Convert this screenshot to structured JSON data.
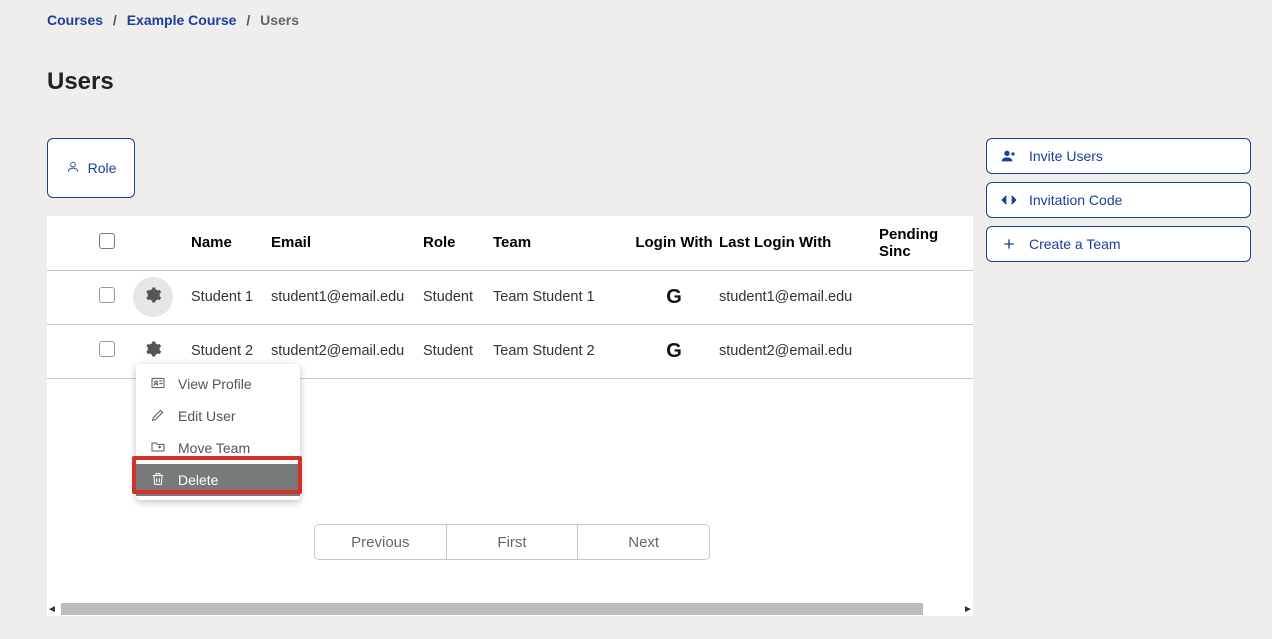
{
  "breadcrumb": {
    "items": [
      {
        "label": "Courses"
      },
      {
        "label": "Example Course"
      }
    ],
    "current": "Users"
  },
  "page_title": "Users",
  "role_button_label": "Role",
  "side_actions": {
    "invite_users": "Invite Users",
    "invitation_code": "Invitation Code",
    "create_team": "Create a Team"
  },
  "table": {
    "headers": {
      "name": "Name",
      "email": "Email",
      "role": "Role",
      "team": "Team",
      "login_with": "Login With",
      "last_login_with": "Last Login With",
      "pending_since": "Pending Sinc"
    },
    "rows": [
      {
        "name": "Student 1",
        "email": "student1@email.edu",
        "role": "Student",
        "team": "Team Student 1",
        "login_with": "G",
        "last_login_with": "student1@email.edu",
        "pending_since": ""
      },
      {
        "name": "Student 2",
        "email": "student2@email.edu",
        "role": "Student",
        "team": "Team Student 2",
        "login_with": "G",
        "last_login_with": "student2@email.edu",
        "pending_since": ""
      }
    ]
  },
  "row_menu": {
    "view_profile": "View Profile",
    "edit_user": "Edit User",
    "move_team": "Move Team",
    "delete": "Delete"
  },
  "pager": {
    "previous": "Previous",
    "first": "First",
    "next": "Next"
  }
}
